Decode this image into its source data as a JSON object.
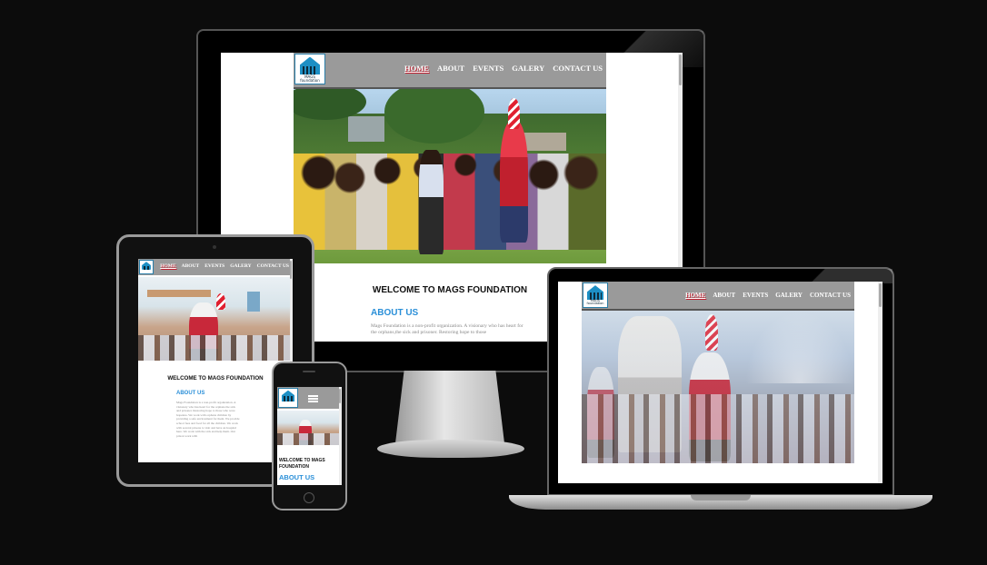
{
  "site": {
    "logo_text": "MAGS foundation",
    "nav_links": [
      "HOME",
      "ABOUT",
      "EVENTS",
      "GALERY",
      "CONTACT US"
    ],
    "welcome": "WELCOME TO MAGS FOUNDATION",
    "about_heading": "ABOUT US",
    "about_desktop": "Mags Foundation is a non-profit organization. A visionary who has heart for the orphans,the sick and prisoner. Restoring hope to those",
    "about_tablet": "Mags Foundation is a non-profit organization. A visionary who has heart for the orphans the sick and prisoner. Restoring hope to those who were hopeless. We work with orphans children by providing a safe environment for them. We provide school fees and food for all the children. We work with several prisons to visit and have an hospital here. We work with the sick and help them. Our prison work with"
  },
  "colors": {
    "page_bg": "#0c0c0c",
    "nav_bg": "#9a9a9a",
    "accent_blue": "#2a8fd8",
    "logo_blue": "#1d8fc4"
  },
  "icons": {
    "hamburger": "hamburger-menu-icon",
    "home_button": "home-button-icon"
  }
}
